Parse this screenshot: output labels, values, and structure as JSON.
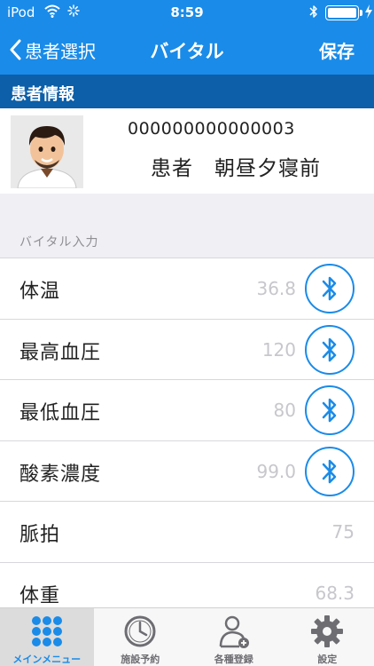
{
  "status_bar": {
    "carrier": "iPod",
    "time": "8:59"
  },
  "nav": {
    "back_label": "患者選択",
    "title": "バイタル",
    "save_label": "保存"
  },
  "patient_section": {
    "header": "患者情報"
  },
  "patient": {
    "id": "000000000000003",
    "name": "患者　朝昼夕寝前"
  },
  "vitals_group_label": "バイタル入力",
  "vitals": [
    {
      "label": "体温",
      "value": "36.8",
      "bluetooth": true
    },
    {
      "label": "最高血圧",
      "value": "120",
      "bluetooth": true
    },
    {
      "label": "最低血圧",
      "value": "80",
      "bluetooth": true
    },
    {
      "label": "酸素濃度",
      "value": "99.0",
      "bluetooth": true
    },
    {
      "label": "脈拍",
      "value": "75",
      "bluetooth": false
    },
    {
      "label": "体重",
      "value": "68.3",
      "bluetooth": false
    }
  ],
  "tabs": [
    {
      "label": "メインメニュー",
      "icon": "grid-dots-icon",
      "active": true
    },
    {
      "label": "施設予約",
      "icon": "clock-icon",
      "active": false
    },
    {
      "label": "各種登録",
      "icon": "person-add-icon",
      "active": false
    },
    {
      "label": "設定",
      "icon": "gear-icon",
      "active": false
    }
  ],
  "colors": {
    "accent": "#1a8be8",
    "section_header": "#0c5fa8",
    "placeholder": "#c7c7cc"
  }
}
